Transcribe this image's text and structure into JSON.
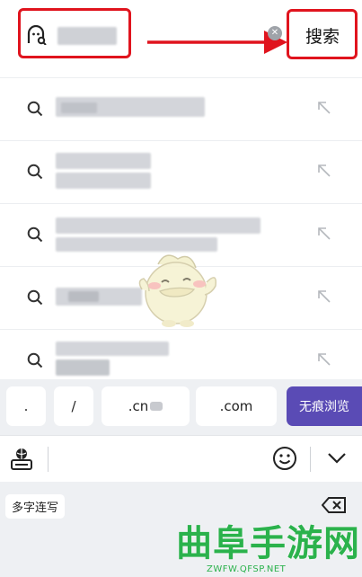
{
  "search": {
    "button_label": "搜索"
  },
  "suggestions": [
    {
      "label": "search-suggestion-1"
    },
    {
      "label": "search-suggestion-2"
    },
    {
      "label": "search-suggestion-3"
    },
    {
      "label": "search-suggestion-4"
    },
    {
      "label": "search-suggestion-5"
    }
  ],
  "quick_keys": {
    "dot": ".",
    "slash": "/",
    "cn": ".cn",
    "com": ".com",
    "incognito": "无痕浏览"
  },
  "keyboard": {
    "mode_label": "多字连写"
  },
  "watermark": {
    "brand": "曲阜手游网",
    "url": "ZWFW.QFSP.NET"
  },
  "colors": {
    "accent": "#5a4bb5",
    "highlight": "#e0141e",
    "watermark_green": "#2bb24c"
  }
}
